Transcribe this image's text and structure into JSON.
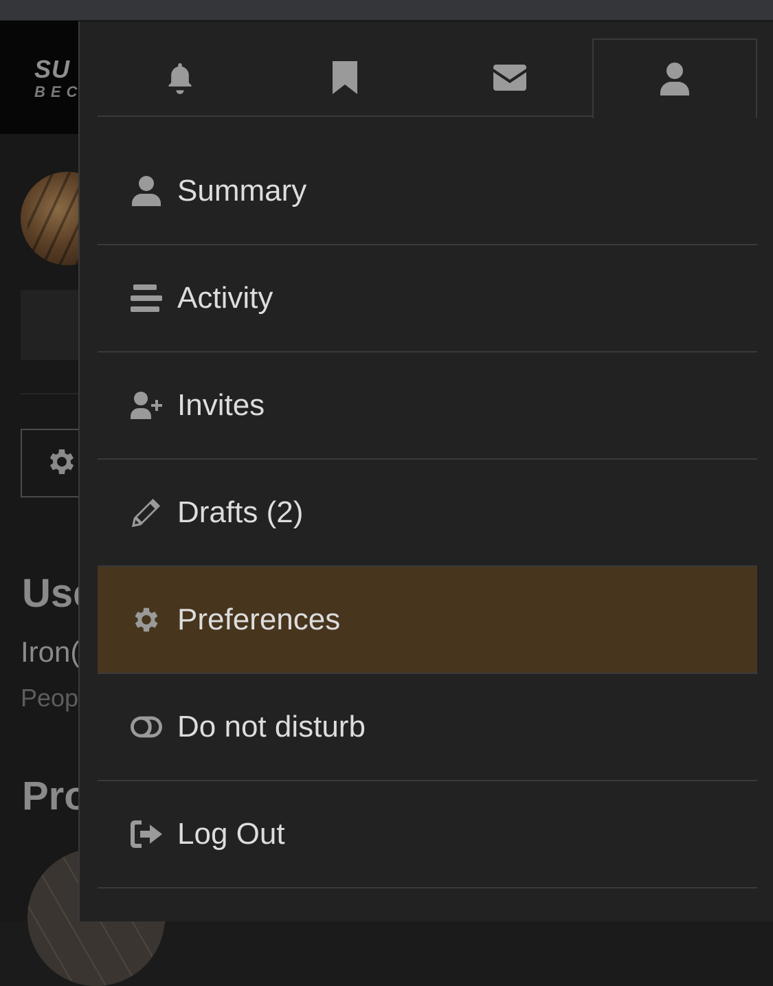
{
  "background": {
    "logo_line1": "SU",
    "logo_line2": "BEC",
    "username_heading": "Use",
    "username": "Iron(",
    "people_label": "Peop",
    "profile_heading": "Pro"
  },
  "tabs": [
    {
      "icon": "bell-icon",
      "name": "notifications"
    },
    {
      "icon": "bookmark-icon",
      "name": "bookmarks"
    },
    {
      "icon": "envelope-icon",
      "name": "messages"
    },
    {
      "icon": "user-icon",
      "name": "profile",
      "active": true
    }
  ],
  "menu": {
    "items": [
      {
        "label": "Summary",
        "icon": "user-icon"
      },
      {
        "label": "Activity",
        "icon": "align-left-icon"
      },
      {
        "label": "Invites",
        "icon": "user-plus-icon"
      },
      {
        "label": "Drafts (2)",
        "icon": "pencil-icon"
      },
      {
        "label": "Preferences",
        "icon": "gear-icon",
        "highlighted": true
      },
      {
        "label": "Do not disturb",
        "icon": "toggle-off-icon"
      },
      {
        "label": "Log Out",
        "icon": "sign-out-icon"
      }
    ]
  },
  "colors": {
    "panel_bg": "#222222",
    "highlight_bg": "#48351e",
    "text": "#dddddd",
    "icon": "#9a9a9a",
    "divider": "#3a3a3a"
  }
}
